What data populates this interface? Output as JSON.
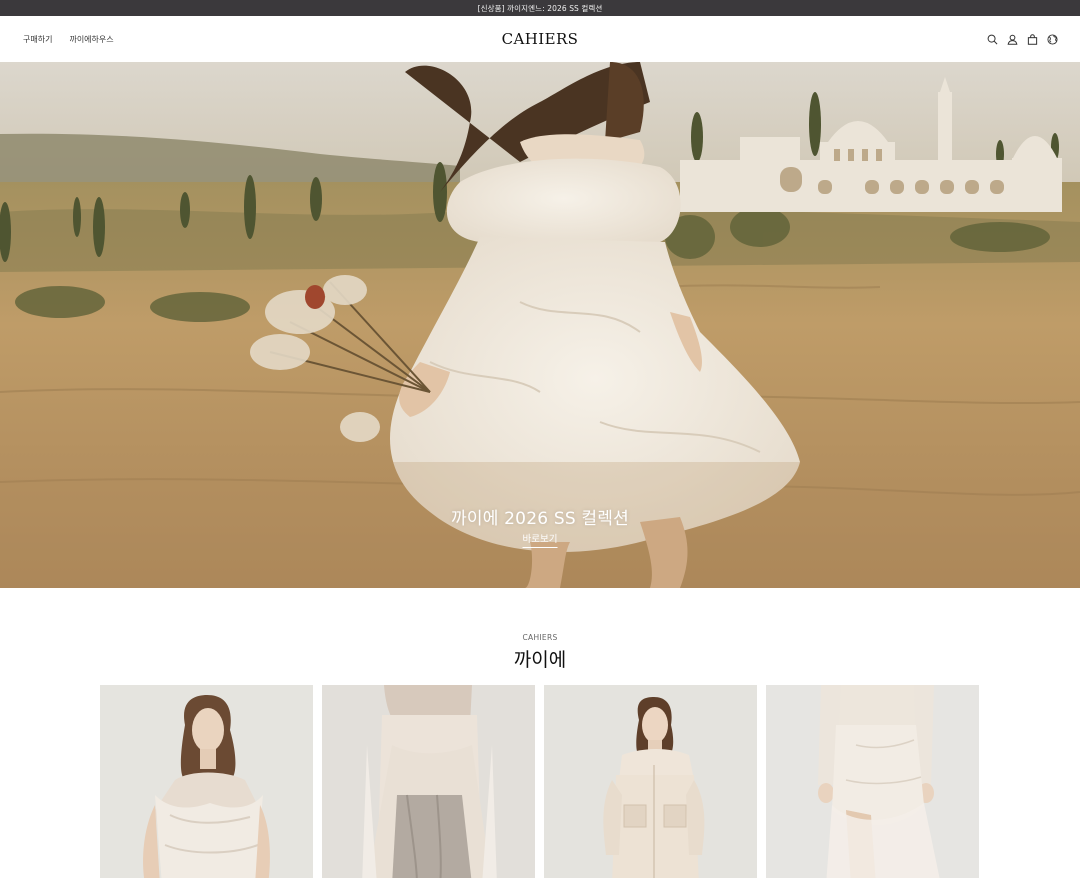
{
  "announcement": "[신상품] 까이지엔느: 2026 SS 컬렉션",
  "header": {
    "nav": [
      "구매하기",
      "까이에하우스"
    ],
    "logo": "CAHIERS",
    "icons": [
      "search-icon",
      "account-icon",
      "cart-icon",
      "globe-icon"
    ]
  },
  "hero": {
    "title": "까이에 2026 SS 컬렉션",
    "cta": "바로보기"
  },
  "section": {
    "subtitle": "CAHIERS",
    "title": "까이에"
  },
  "products": [
    {
      "name": "product-1"
    },
    {
      "name": "product-2"
    },
    {
      "name": "product-3"
    },
    {
      "name": "product-4"
    }
  ]
}
